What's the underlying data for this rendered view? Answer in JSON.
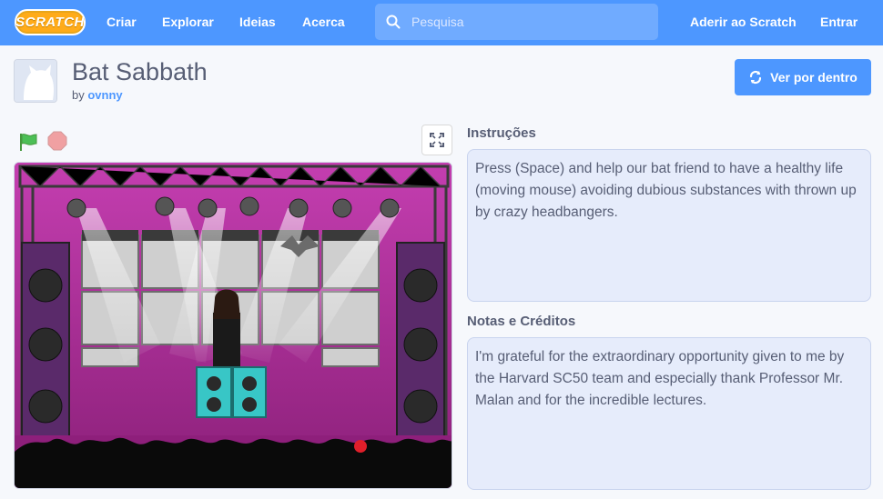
{
  "navbar": {
    "logo": "SCRATCH",
    "links": [
      "Criar",
      "Explorar",
      "Ideias",
      "Acerca"
    ],
    "search_placeholder": "Pesquisa",
    "join": "Aderir ao Scratch",
    "signin": "Entrar"
  },
  "project": {
    "title": "Bat Sabbath",
    "by": "by",
    "author": "ovnny",
    "remix_label": "Ver por dentro"
  },
  "instructions": {
    "label": "Instruções",
    "text": "Press (Space) and help our bat friend to have a healthy life (moving mouse) avoiding dubious substances with thrown up by crazy headbangers."
  },
  "notes": {
    "label": "Notas e Créditos",
    "text": "I'm grateful for the extraordinary opportunity given to me by the Harvard SC50 team and especially thank Professor Mr. Malan and for the incredible lectures."
  },
  "colors": {
    "brand": "#4d97ff",
    "logo": "#ffab19",
    "stage_floor": "#9c1f8a"
  }
}
